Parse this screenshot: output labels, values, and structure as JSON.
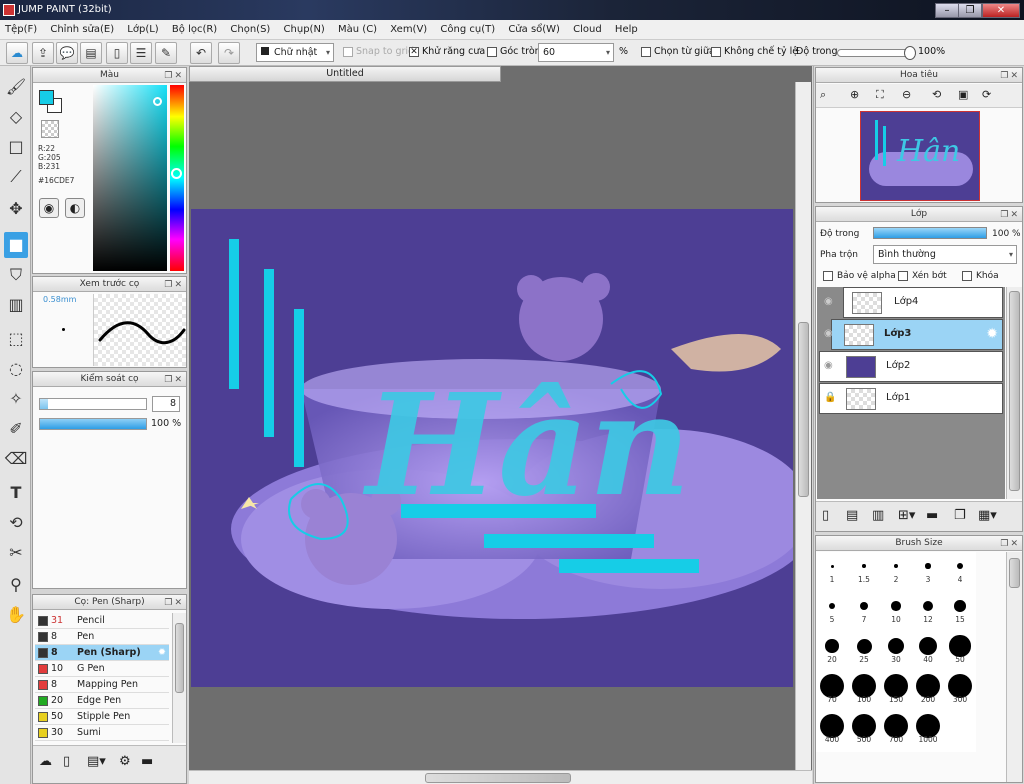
{
  "window": {
    "title": "JUMP PAINT (32bit)"
  },
  "menu": [
    "Tệp(F)",
    "Chỉnh sửa(E)",
    "Lớp(L)",
    "Bộ lọc(R)",
    "Chọn(S)",
    "Chụp(N)",
    "Màu (C)",
    "Xem(V)",
    "Công cụ(T)",
    "Cửa sổ(W)",
    "Cloud",
    "Help"
  ],
  "toolbar": {
    "shape": "Chữ nhật",
    "snap_to_grid": "Snap to grid",
    "antialias": "Khử răng cưa",
    "round_corner": "Góc tròn",
    "round_value": "60",
    "percent": "%",
    "select_center": "Chọn từ giữa",
    "keep_ratio": "Không chế tỷ lệ",
    "opacity_label": "Độ trong",
    "opacity_value": "100%",
    "opacity_level": 1.0
  },
  "color_panel": {
    "title": "Màu",
    "r": "R:22",
    "g": "G:205",
    "b": "B:231",
    "hex": "#16CDE7",
    "fg_color": "#16CDE7"
  },
  "brush_preview": {
    "title": "Xem trước cọ",
    "size": "0.58mm"
  },
  "brush_control": {
    "title": "Kiểm soát cọ",
    "size_value": "8",
    "opacity_value": "100 %",
    "size_level": 0.08,
    "opacity_level": 1.0
  },
  "brush_list": {
    "title": "Cọ: Pen (Sharp)",
    "items": [
      {
        "size": "31",
        "name": "Pencil",
        "color": "#333333"
      },
      {
        "size": "8",
        "name": "Pen",
        "color": "#333333"
      },
      {
        "size": "8",
        "name": "Pen (Sharp)",
        "color": "#333333"
      },
      {
        "size": "10",
        "name": "G Pen",
        "color": "#e23c3c"
      },
      {
        "size": "8",
        "name": "Mapping Pen",
        "color": "#e23c3c"
      },
      {
        "size": "20",
        "name": "Edge Pen",
        "color": "#22aa22"
      },
      {
        "size": "50",
        "name": "Stipple Pen",
        "color": "#e8d020"
      },
      {
        "size": "30",
        "name": "Sumi",
        "color": "#e8d020"
      }
    ]
  },
  "canvas": {
    "tab": "Untitled",
    "art_text": "Hân"
  },
  "navigator": {
    "title": "Hoa tiêu"
  },
  "layers": {
    "title": "Lớp",
    "opacity_label": "Độ trong",
    "opacity_value": "100 %",
    "opacity_level": 1.0,
    "blend_label": "Pha trộn",
    "blend_value": "Bình thường",
    "protect_alpha": "Bảo vệ alpha",
    "clipping": "Xén bớt",
    "lock": "Khóa",
    "items": [
      {
        "name": "Lớp4"
      },
      {
        "name": "Lớp3"
      },
      {
        "name": "Lớp2"
      },
      {
        "name": "Lớp1"
      }
    ]
  },
  "brush_size": {
    "title": "Brush Size",
    "sizes": [
      "1",
      "1.5",
      "2",
      "3",
      "4",
      "5",
      "7",
      "10",
      "12",
      "15",
      "20",
      "25",
      "30",
      "40",
      "50",
      "70",
      "100",
      "150",
      "200",
      "300",
      "400",
      "500",
      "700",
      "1000"
    ]
  }
}
